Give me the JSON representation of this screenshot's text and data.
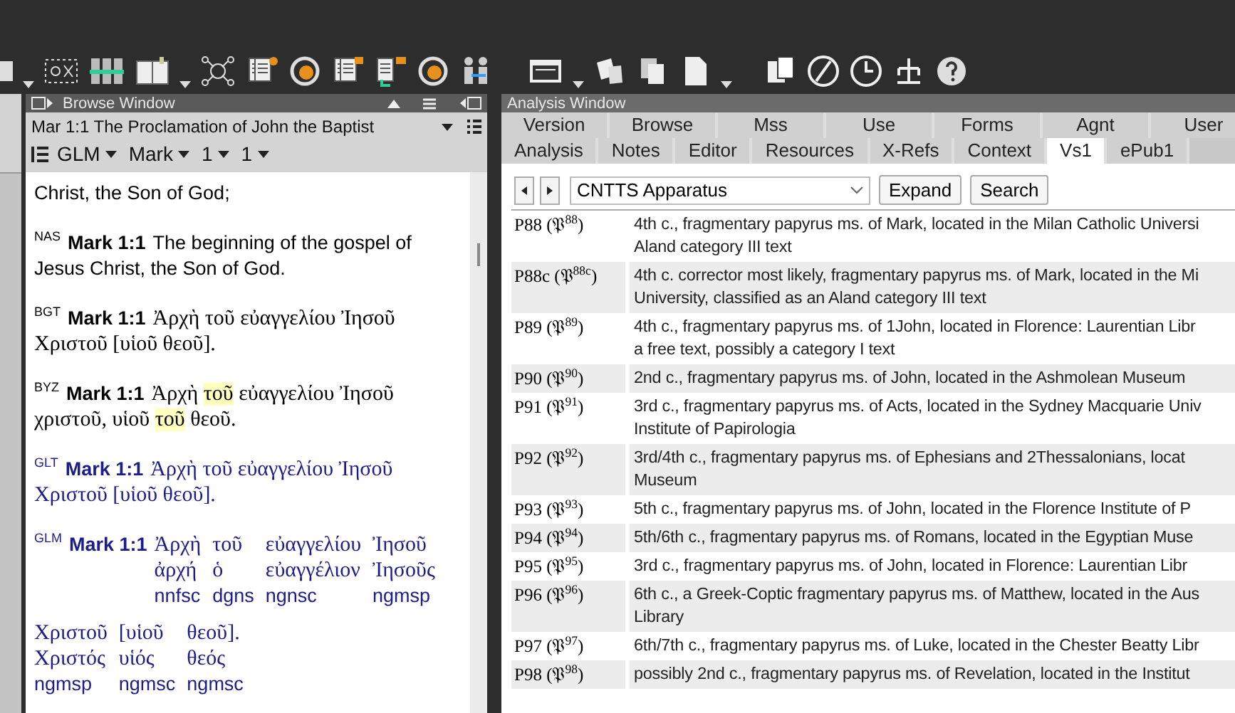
{
  "browse_window": {
    "title": "Browse Window",
    "heading": "Mar 1:1 The Proclamation of John the Baptist",
    "selectors": [
      {
        "label": "GLM"
      },
      {
        "label": "Mark"
      },
      {
        "label": "1"
      },
      {
        "label": "1"
      }
    ],
    "passages": [
      {
        "kind": "continuation",
        "text": "Christ, the Son of God;"
      },
      {
        "kind": "verse",
        "version": "NAS",
        "ref": "Mark 1:1",
        "color": "#000000",
        "segments": [
          {
            "text": "The beginning of the gospel of Jesus Christ, the Son of God.",
            "highlighted": false
          }
        ]
      },
      {
        "kind": "greek-verse",
        "version": "BGT",
        "ref": "Mark 1:1",
        "color": "#000000",
        "segments": [
          {
            "text": "Ἀρχὴ τοῦ εὐαγγελίου Ἰησοῦ Χριστοῦ [υἱοῦ θεοῦ].",
            "highlighted": false
          }
        ]
      },
      {
        "kind": "greek-verse",
        "version": "BYZ",
        "ref": "Mark 1:1",
        "color": "#000000",
        "segments": [
          {
            "text": "Ἀρχὴ ",
            "highlighted": false
          },
          {
            "text": "τοῦ",
            "highlighted": true
          },
          {
            "text": " εὐαγγελίου Ἰησοῦ χριστοῦ, υἱοῦ ",
            "highlighted": false
          },
          {
            "text": "τοῦ",
            "highlighted": true
          },
          {
            "text": " θεοῦ.",
            "highlighted": false
          }
        ]
      },
      {
        "kind": "greek-verse",
        "version": "GLT",
        "ref": "Mark 1:1",
        "color": "#1c1c8a",
        "segments": [
          {
            "text": "Ἀρχὴ τοῦ εὐαγγελίου Ἰησοῦ Χριστοῦ [υἱοῦ θεοῦ].",
            "highlighted": false
          }
        ]
      },
      {
        "kind": "interlinear",
        "version": "GLM",
        "ref": "Mark 1:1",
        "color": "#1c1c8a",
        "words": [
          {
            "form": "Ἀρχὴ",
            "lemma": "ἀρχή",
            "parse": "nnfsc"
          },
          {
            "form": "τοῦ",
            "lemma": "ὁ",
            "parse": "dgns"
          },
          {
            "form": "εὐαγγελίου",
            "lemma": "εὐαγγέλιον",
            "parse": "ngnsc"
          },
          {
            "form": "Ἰησοῦ",
            "lemma": "Ἰησοῦς",
            "parse": "ngmsp"
          },
          {
            "form": "Χριστοῦ",
            "lemma": "Χριστός",
            "parse": "ngmsp"
          },
          {
            "form": "[υἱοῦ",
            "lemma": "υἱός",
            "parse": "ngmsc"
          },
          {
            "form": "θεοῦ].",
            "lemma": "θεός",
            "parse": "ngmsc"
          }
        ]
      }
    ]
  },
  "analysis_window": {
    "title": "Analysis Window",
    "tab_rows": [
      [
        {
          "label": "Version",
          "selected": false
        },
        {
          "label": "Browse",
          "selected": false
        },
        {
          "label": "Mss",
          "selected": false
        },
        {
          "label": "Use",
          "selected": false
        },
        {
          "label": "Forms",
          "selected": false
        },
        {
          "label": "Agnt",
          "selected": false
        },
        {
          "label": "User",
          "selected": false
        }
      ],
      [
        {
          "label": "Analysis",
          "selected": false
        },
        {
          "label": "Notes",
          "selected": false
        },
        {
          "label": "Editor",
          "selected": false
        },
        {
          "label": "Resources",
          "selected": false
        },
        {
          "label": "X-Refs",
          "selected": false
        },
        {
          "label": "Context",
          "selected": false
        },
        {
          "label": "Vs1",
          "selected": true
        },
        {
          "label": "ePub1",
          "selected": false
        }
      ]
    ],
    "source_select": {
      "value": "CNTTS Apparatus"
    },
    "buttons": [
      "Expand",
      "Search"
    ],
    "table": {
      "rows": [
        {
          "siglum": "P88 (𝔓$^{88}$)",
          "lines": [
            "4th c., fragmentary papyrus ms. of Mark, located in the Milan Catholic Universi",
            "Aland category III text"
          ]
        },
        {
          "siglum": "P88c (𝔓$^{88c}$)",
          "lines": [
            "4th c. corrector most likely, fragmentary papyrus ms. of Mark, located in the Mi",
            "University, classified as an Aland category III text"
          ]
        },
        {
          "siglum": "P89 (𝔓$^{89}$)",
          "lines": [
            "4th c., fragmentary papyrus ms. of 1John, located in Florence: Laurentian Libr",
            "a free text, possibly a category I text"
          ]
        },
        {
          "siglum": "P90 (𝔓$^{90}$)",
          "lines": [
            "2nd c., fragmentary papyrus ms. of John, located in the Ashmolean Museum"
          ]
        },
        {
          "siglum": "P91 (𝔓$^{91}$)",
          "lines": [
            "3rd c., fragmentary papyrus ms. of Acts, located in the Sydney Macquarie Univ",
            "Institute of Papirologia"
          ]
        },
        {
          "siglum": "P92 (𝔓$^{92}$)",
          "lines": [
            "3rd/4th c., fragmentary papyrus ms. of Ephesians and 2Thessalonians, locat",
            "Museum"
          ]
        },
        {
          "siglum": "P93 (𝔓$^{93}$)",
          "lines": [
            "5th c., fragmentary papyrus ms. of John, located in the Florence Institute of P"
          ]
        },
        {
          "siglum": "P94 (𝔓$^{94}$)",
          "lines": [
            "5th/6th c., fragmentary papyrus ms. of Romans, located in the Egyptian Muse"
          ]
        },
        {
          "siglum": "P95 (𝔓$^{95}$)",
          "lines": [
            "3rd c., fragmentary papyrus ms. of John, located in Florence: Laurentian Libr"
          ]
        },
        {
          "siglum": "P96 (𝔓$^{96}$)",
          "lines": [
            "6th c., a Greek-Coptic fragmentary papyrus ms. of Matthew, located in the Aus",
            "Library"
          ]
        },
        {
          "siglum": "P97 (𝔓$^{97}$)",
          "lines": [
            "6th/7th c., fragmentary papyrus ms. of Luke, located in the Chester Beatty Libr"
          ]
        },
        {
          "siglum": "P98 (𝔓$^{98}$)",
          "lines": [
            "possibly 2nd c., fragmentary papyrus ms. of Revelation, located in the Institut"
          ]
        }
      ]
    }
  }
}
